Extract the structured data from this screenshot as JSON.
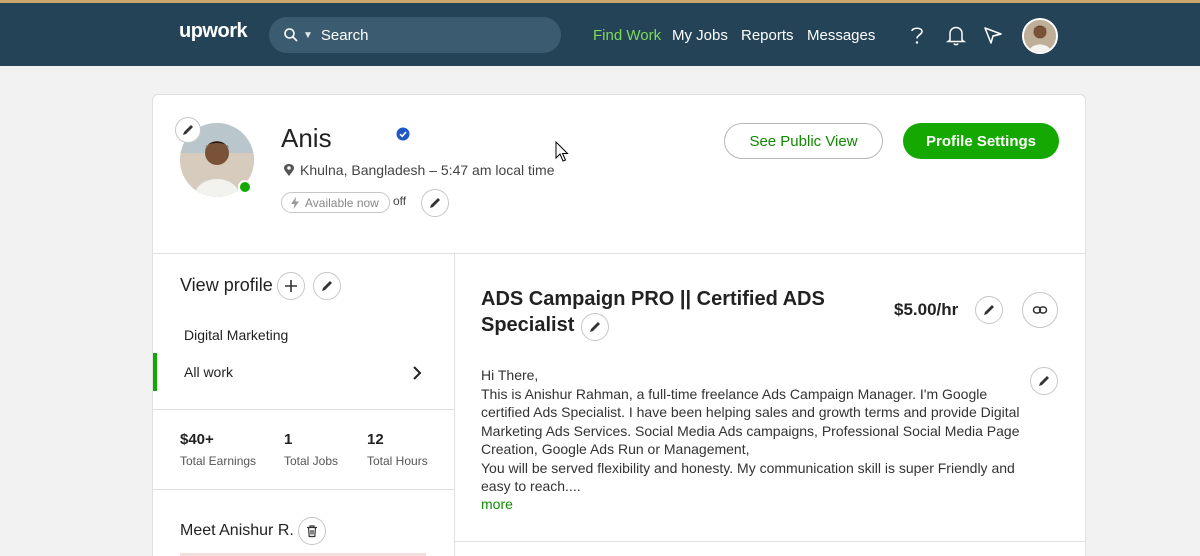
{
  "header": {
    "logo": "upwork",
    "search_placeholder": "Search",
    "nav": [
      "Find Work",
      "My Jobs",
      "Reports",
      "Messages"
    ],
    "active_nav": "Find Work",
    "icons": [
      "help-icon",
      "bell-icon",
      "send-icon"
    ]
  },
  "profile": {
    "name": "Anis",
    "verified": true,
    "location": "Khulna, Bangladesh – 5:47 am local time",
    "availability_label": "Available now",
    "availability_state": "off",
    "see_public_view": "See Public View",
    "profile_settings": "Profile Settings"
  },
  "sidebar": {
    "view_profile": "View profile",
    "categories": [
      "Digital Marketing",
      "All work"
    ],
    "active_category": "All work",
    "stats": [
      {
        "value": "$40+",
        "label": "Total Earnings"
      },
      {
        "value": "1",
        "label": "Total Jobs"
      },
      {
        "value": "12",
        "label": "Total Hours"
      }
    ],
    "meet": "Meet Anishur R."
  },
  "main": {
    "title": "ADS Campaign PRO || Certified ADS Specialist",
    "rate": "$5.00/hr",
    "description": [
      "Hi There,",
      "This is Anishur Rahman, a full-time freelance Ads Campaign Manager. I'm Google certified Ads Specialist. I have been helping sales and growth terms and provide Digital Marketing Ads Services. Social Media Ads campaigns, Professional Social Media Page Creation, Google Ads Run or Management,",
      "You will be served flexibility and honesty. My communication skill is super Friendly and easy to reach...."
    ],
    "more": "more"
  },
  "colors": {
    "header_bg": "#244357",
    "accent_green": "#14a800",
    "link_green": "#108a00",
    "verified_blue": "#1f57c3"
  }
}
